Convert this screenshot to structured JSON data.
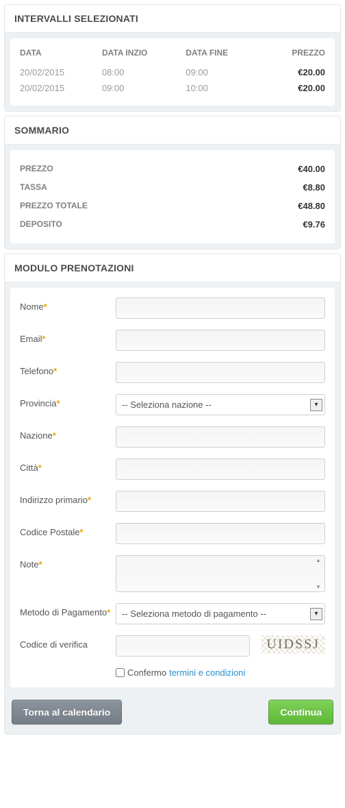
{
  "intervals": {
    "title": "INTERVALLI SELEZIONATI",
    "headers": {
      "data": "DATA",
      "inizio": "DATA INZIO",
      "fine": "DATA FINE",
      "prezzo": "PREZZO"
    },
    "rows": [
      {
        "data": "20/02/2015",
        "inizio": "08:00",
        "fine": "09:00",
        "prezzo": "€20.00"
      },
      {
        "data": "20/02/2015",
        "inizio": "09:00",
        "fine": "10:00",
        "prezzo": "€20.00"
      }
    ]
  },
  "summary": {
    "title": "SOMMARIO",
    "rows": [
      {
        "label": "PREZZO",
        "value": "€40.00"
      },
      {
        "label": "TASSA",
        "value": "€8.80"
      },
      {
        "label": "PREZZO TOTALE",
        "value": "€48.80"
      },
      {
        "label": "DEPOSITO",
        "value": "€9.76"
      }
    ]
  },
  "form": {
    "title": "MODULO PRENOTAZIONI",
    "fields": {
      "name": "Nome",
      "email": "Email",
      "phone": "Telefono",
      "province": "Provincia",
      "province_placeholder": "-- Seleziona nazione --",
      "nation": "Nazione",
      "city": "Città",
      "address": "Indirizzo primario",
      "postal": "Codice Postale",
      "notes": "Note",
      "payment": "Metodo di Pagamento",
      "payment_placeholder": "-- Seleziona metodo di pagamento --",
      "captcha": "Codice di verifica",
      "captcha_text": "UIDSSJ"
    },
    "confirm_prefix": "Confermo ",
    "confirm_link": "termini e condizioni"
  },
  "buttons": {
    "back": "Torna al calendario",
    "continue": "Continua"
  }
}
